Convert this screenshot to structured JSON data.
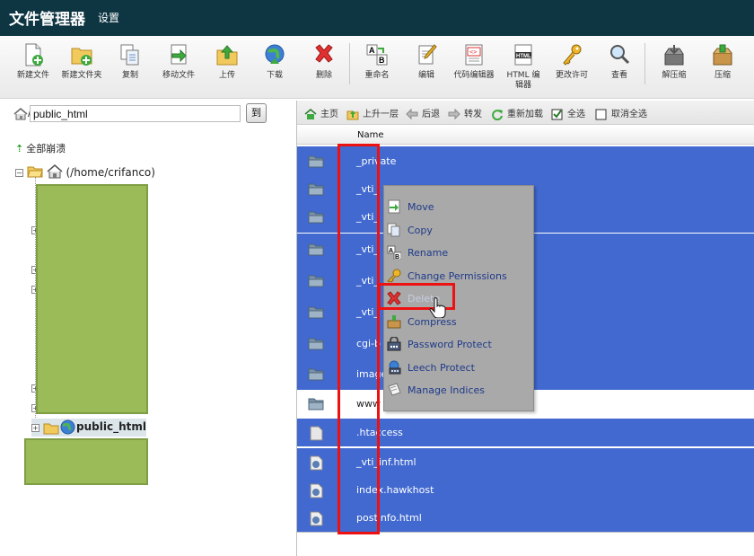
{
  "header": {
    "title": "文件管理器",
    "settings": "设置"
  },
  "toolbar": {
    "buttons": [
      {
        "id": "new-file",
        "label": "新建文件"
      },
      {
        "id": "new-folder",
        "label": "新建文件夹"
      },
      {
        "id": "copy",
        "label": "复制"
      },
      {
        "id": "move",
        "label": "移动文件"
      },
      {
        "id": "upload",
        "label": "上传"
      },
      {
        "id": "download",
        "label": "下载"
      },
      {
        "id": "delete",
        "label": "删除"
      },
      {
        "id": "rename",
        "label": "重命名"
      },
      {
        "id": "edit",
        "label": "编辑"
      },
      {
        "id": "code-editor",
        "label": "代码编辑器"
      },
      {
        "id": "html-editor",
        "label": "HTML 编辑器",
        "line1": "HTML 编",
        "line2": "辑器"
      },
      {
        "id": "permissions",
        "label": "更改许可"
      },
      {
        "id": "view",
        "label": "查看"
      },
      {
        "id": "extract",
        "label": "解压缩"
      },
      {
        "id": "compress",
        "label": "压缩"
      }
    ]
  },
  "path": {
    "value": "public_html",
    "go": "到"
  },
  "tree": {
    "collapse_all": "全部崩溃",
    "root": "(/home/crifanco)",
    "selected": "public_html"
  },
  "nav": {
    "home": "主页",
    "up": "上升一层",
    "back": "后退",
    "forward": "转发",
    "reload": "重新加载",
    "select_all": "全选",
    "deselect_all": "取消全选"
  },
  "list": {
    "column_name": "Name",
    "rows": [
      {
        "name": "_private",
        "type": "folder",
        "selected": true
      },
      {
        "name": "_vti_",
        "type": "folder",
        "selected": true
      },
      {
        "name": "_vti_",
        "type": "folder",
        "selected": true
      },
      {
        "name": "_vti_",
        "type": "folder",
        "selected": true
      },
      {
        "name": "_vti_",
        "type": "folder",
        "selected": true
      },
      {
        "name": "_vti_",
        "type": "folder",
        "selected": true
      },
      {
        "name": "cgi-b",
        "type": "folder",
        "selected": true
      },
      {
        "name": "image",
        "type": "folder",
        "selected": true
      },
      {
        "name": "www",
        "type": "folder",
        "selected": false
      },
      {
        "name": ".htaccess",
        "type": "file",
        "selected": true
      },
      {
        "name": "_vti_inf.html",
        "type": "web",
        "selected": true
      },
      {
        "name": "index.hawkhost",
        "type": "web",
        "selected": true
      },
      {
        "name": "postinfo.html",
        "type": "web",
        "selected": true
      }
    ]
  },
  "context_menu": {
    "items": [
      {
        "label": "Move",
        "icon": "move-icon"
      },
      {
        "label": "Copy",
        "icon": "copy-icon"
      },
      {
        "label": "Rename",
        "icon": "rename-icon"
      },
      {
        "label": "Change Permissions",
        "icon": "key-icon"
      },
      {
        "label": "Delete",
        "icon": "delete-icon",
        "disabled": true
      },
      {
        "label": "Compress",
        "icon": "compress-icon"
      },
      {
        "label": "Password Protect",
        "icon": "password-icon"
      },
      {
        "label": "Leech Protect",
        "icon": "leech-icon"
      },
      {
        "label": "Manage Indices",
        "icon": "indices-icon"
      }
    ]
  },
  "colors": {
    "header_bg": "#0d3542",
    "selected_row": "#4169cf",
    "annotation_red": "#ee1111",
    "redaction_green": "#9bbb59"
  }
}
